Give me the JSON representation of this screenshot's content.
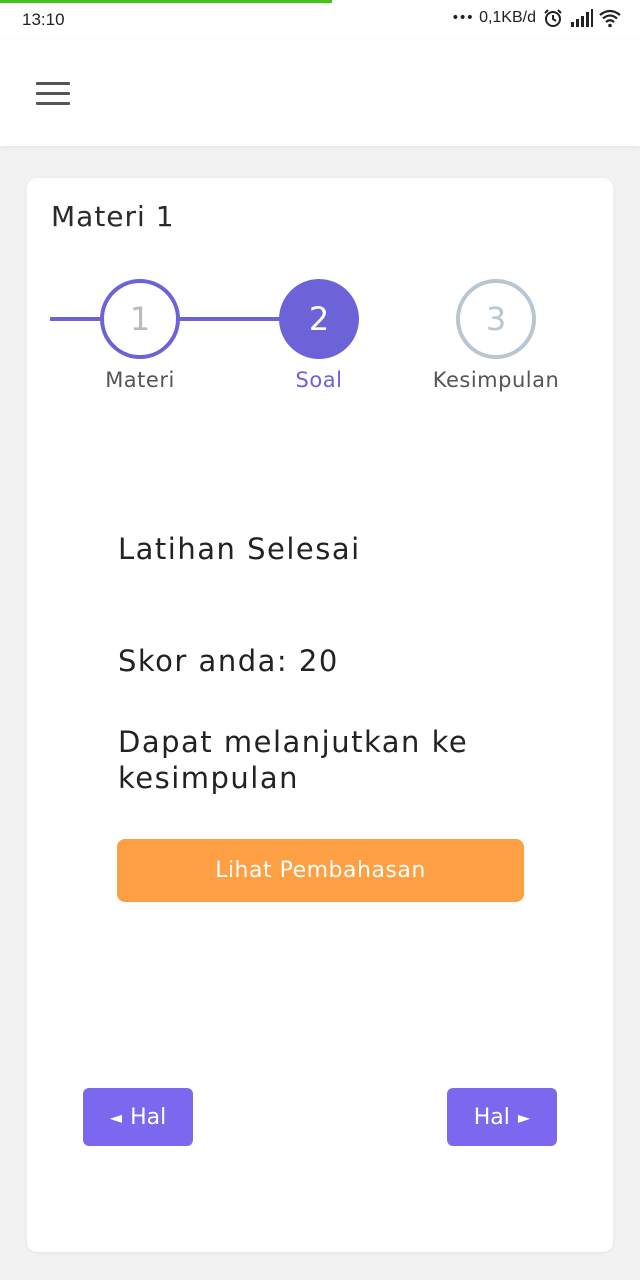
{
  "status_bar": {
    "time": "13:10",
    "dots": "•••",
    "network_speed": "0,1KB/d",
    "icons": [
      "alarm-icon",
      "signal-icon",
      "wifi-icon"
    ]
  },
  "app_bar": {
    "menu_icon": "hamburger-menu-icon"
  },
  "card": {
    "title": "Materi 1",
    "stepper": [
      {
        "number": "1",
        "label": "Materi",
        "state": "done"
      },
      {
        "number": "2",
        "label": "Soal",
        "state": "active"
      },
      {
        "number": "3",
        "label": "Kesimpulan",
        "state": "pending"
      }
    ],
    "result": {
      "title": "Latihan Selesai",
      "score": "Skor anda: 20",
      "message": "Dapat melanjutkan ke kesimpulan"
    },
    "review_button_label": "Lihat Pembahasan",
    "prev_button": {
      "arrow": "◄",
      "label": "Hal"
    },
    "next_button": {
      "arrow": "►",
      "label": "Hal"
    }
  },
  "colors": {
    "accent": "#6c63d9",
    "nav_button": "#7b68ee",
    "review_button": "#ff9f43",
    "pending_step": "#b8c6d2",
    "progress_bar": "#43c21a"
  }
}
